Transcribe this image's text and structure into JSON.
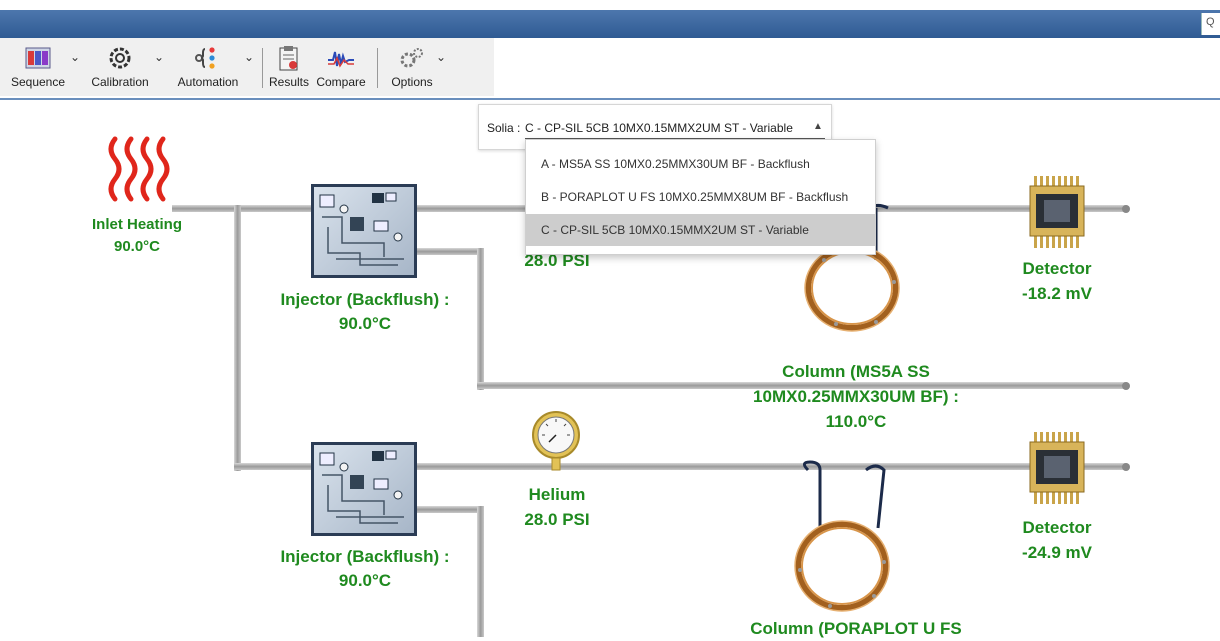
{
  "toolbar": {
    "items": [
      {
        "label": "Sequence"
      },
      {
        "label": "Calibration"
      },
      {
        "label": "Automation"
      },
      {
        "label": "Results"
      },
      {
        "label": "Compare"
      },
      {
        "label": "Options"
      }
    ]
  },
  "search": {
    "glyph": "Q"
  },
  "inlet": {
    "label": "Inlet Heating",
    "value": "90.0°C"
  },
  "channels": [
    {
      "injector": {
        "label": "Injector (Backflush) :",
        "value": "90.0°C"
      },
      "pressure": {
        "value": "28.0 PSI"
      },
      "column": {
        "line1": "Column (MS5A SS",
        "line2": "10MX0.25MMX30UM BF) :",
        "line3": "110.0°C"
      },
      "detector": {
        "label": "Detector",
        "value": "-18.2 mV"
      }
    },
    {
      "injector": {
        "label": "Injector (Backflush) :",
        "value": "90.0°C"
      },
      "pressure": {
        "label": "Helium",
        "value": "28.0 PSI"
      },
      "column": {
        "line1": "Column (PORAPLOT U FS"
      },
      "detector": {
        "label": "Detector",
        "value": "-24.9 mV"
      }
    }
  ],
  "dropdown": {
    "label": "Solia :",
    "selected": "C - CP-SIL 5CB 10MX0.15MMX2UM ST - Variable",
    "options": [
      "A - MS5A SS 10MX0.25MMX30UM BF - Backflush",
      "B - PORAPLOT U FS 10MX0.25MMX8UM BF - Backflush",
      "C - CP-SIL 5CB 10MX0.15MMX2UM ST - Variable"
    ]
  },
  "colors": {
    "label_green": "#1f8a1f",
    "titlebar_blue": "#3a64a0"
  }
}
